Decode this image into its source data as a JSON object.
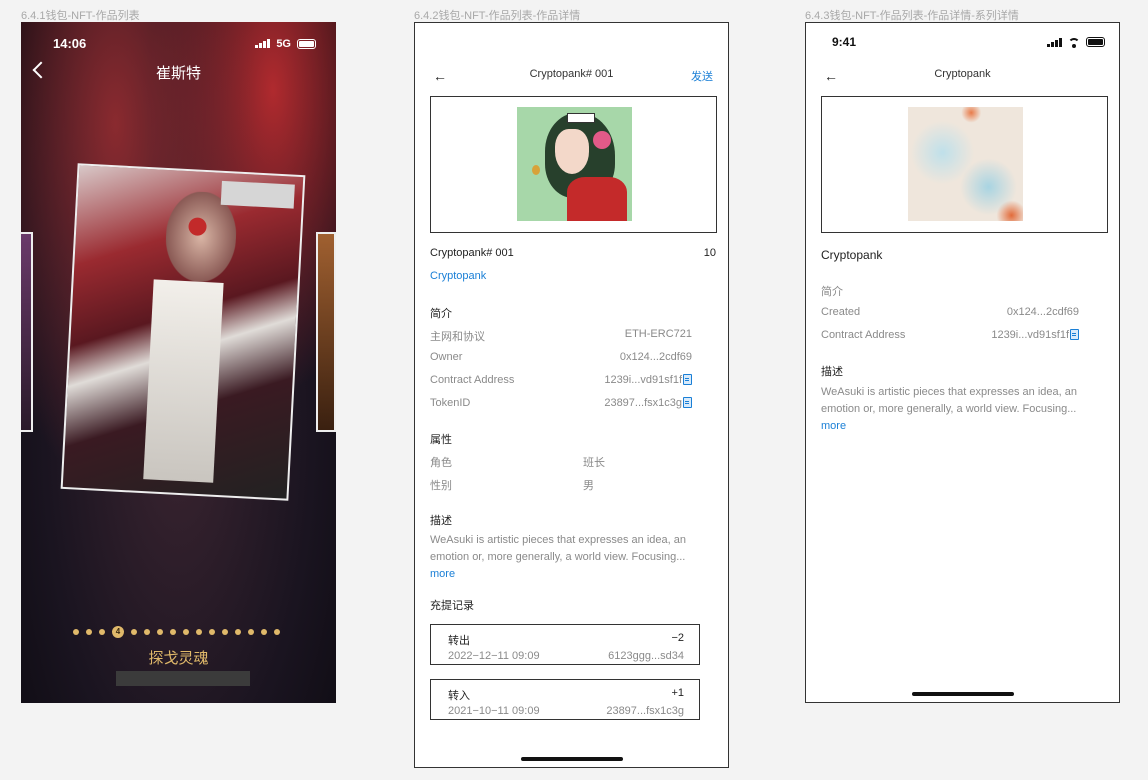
{
  "labels": {
    "frame1": "6.4.1钱包-NFT-作品列表",
    "frame2": "6.4.2钱包-NFT-作品列表-作品详情",
    "frame3": "6.4.3钱包-NFT-作品列表-作品详情-系列详情"
  },
  "screen1": {
    "time": "14:06",
    "network": "5G",
    "title": "崔斯特",
    "active_page": "4",
    "dot_count": 16,
    "active_index": 3,
    "work_name": "探戈灵魂"
  },
  "screen2": {
    "nav_title": "Cryptopank# 001",
    "send_label": "发送",
    "item_name": "Cryptopank# 001",
    "item_count": "10",
    "collection_link": "Cryptopank",
    "intro_title": "简介",
    "intro_rows": [
      {
        "label": "主网和协议",
        "value": "ETH-ERC721",
        "copy": false
      },
      {
        "label": "Owner",
        "value": "0x124...2cdf69",
        "copy": false
      },
      {
        "label": "Contract Address",
        "value": "1239i...vd91sf1f",
        "copy": true
      },
      {
        "label": "TokenID",
        "value": "23897...fsx1c3g",
        "copy": true
      }
    ],
    "attr_title": "属性",
    "attr_rows": [
      {
        "label": "角色",
        "value": "班长"
      },
      {
        "label": "性别",
        "value": "男"
      }
    ],
    "desc_title": "描述",
    "desc_line1": "WeAsuki is artistic pieces that expresses an idea, an",
    "desc_line2": "emotion or, more generally, a world view. Focusing...",
    "more": "more",
    "records_title": "充提记录",
    "records": [
      {
        "type": "转出",
        "amount": "−2",
        "date": "2022−12−11 09:09",
        "hash": "6123ggg...sd34"
      },
      {
        "type": "转入",
        "amount": "+1",
        "date": "2021−10−11 09:09",
        "hash": "23897...fsx1c3g"
      }
    ]
  },
  "screen3": {
    "time": "9:41",
    "nav_title": "Cryptopank",
    "collection_name": "Cryptopank",
    "intro_title": "简介",
    "intro_rows": [
      {
        "label": "Created",
        "value": "0x124...2cdf69",
        "copy": false
      },
      {
        "label": "Contract Address",
        "value": "1239i...vd91sf1f",
        "copy": true
      }
    ],
    "desc_title": "描述",
    "desc_line1": "WeAsuki is artistic pieces that expresses an idea, an",
    "desc_line2": "emotion or, more generally, a world view. Focusing...",
    "more": "more"
  }
}
